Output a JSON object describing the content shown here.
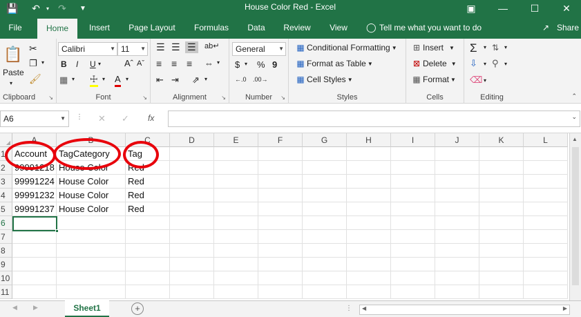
{
  "titlebar": {
    "title": "House Color Red  -  Excel"
  },
  "tabs": [
    {
      "label": "File"
    },
    {
      "label": "Home"
    },
    {
      "label": "Insert"
    },
    {
      "label": "Page Layout"
    },
    {
      "label": "Formulas"
    },
    {
      "label": "Data"
    },
    {
      "label": "Review"
    },
    {
      "label": "View"
    }
  ],
  "tellme": "Tell me what you want to do",
  "share": "Share",
  "ribbon": {
    "clipboard": {
      "paste": "Paste",
      "label": "Clipboard"
    },
    "font": {
      "name": "Calibri",
      "size": "11",
      "label": "Font",
      "bold": "B",
      "italic": "I",
      "underline": "U"
    },
    "alignment": {
      "label": "Alignment"
    },
    "number": {
      "format": "General",
      "label": "Number",
      "currency": "$",
      "percent": "%",
      "comma": "9"
    },
    "styles": {
      "conditional": "Conditional Formatting",
      "table": "Format as Table",
      "cell": "Cell Styles",
      "label": "Styles"
    },
    "cells": {
      "insert": "Insert",
      "delete": "Delete",
      "format": "Format",
      "label": "Cells"
    },
    "editing": {
      "label": "Editing"
    }
  },
  "formula": {
    "namebox": "A6",
    "fx": "fx",
    "value": ""
  },
  "grid": {
    "columns": [
      "A",
      "B",
      "C",
      "D",
      "E",
      "F",
      "G",
      "H",
      "I",
      "J",
      "K",
      "L"
    ],
    "rows": [
      "1",
      "2",
      "3",
      "4",
      "5",
      "6",
      "7",
      "8",
      "9",
      "10",
      "11"
    ],
    "cells": [
      [
        "Account",
        "TagCategory",
        "Tag"
      ],
      [
        "99991218",
        "House Color",
        "Red"
      ],
      [
        "99991224",
        "House Color",
        "Red"
      ],
      [
        "99991232",
        "House Color",
        "Red"
      ],
      [
        "99991237",
        "House Color",
        "Red"
      ]
    ]
  },
  "sheet": {
    "tab": "Sheet1",
    "add": "+"
  },
  "colors": {
    "accent": "#217346",
    "annotation": "#e8000b"
  }
}
